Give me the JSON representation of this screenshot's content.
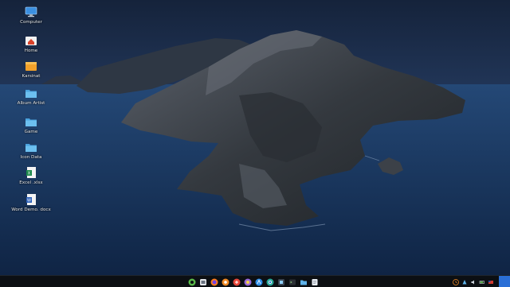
{
  "desktop": {
    "icons": [
      {
        "label": "Computer",
        "icon": "computer-icon"
      },
      {
        "label": "Home",
        "icon": "home-folder-icon"
      },
      {
        "label": "Karsinat",
        "icon": "folder-orange-icon"
      },
      {
        "label": "Album Artist",
        "icon": "folder-icon"
      },
      {
        "label": "Game",
        "icon": "folder-icon"
      },
      {
        "label": "Icon Data",
        "icon": "folder-icon"
      },
      {
        "label": "Excel .xlsx",
        "icon": "excel-file-icon"
      },
      {
        "label": "Word Demo. docx",
        "icon": "word-file-icon"
      }
    ]
  },
  "taskbar": {
    "dock_apps": [
      "start-menu-icon",
      "files-icon",
      "firefox-icon",
      "app-orange-icon",
      "app-red-icon",
      "app-purple-icon",
      "app-store-icon",
      "chrome-icon",
      "software-icon",
      "terminal-icon",
      "folder-icon",
      "text-editor-icon"
    ],
    "tray": {
      "items": [
        "clock-icon",
        "network-icon",
        "volume-icon",
        "battery-icon",
        "flag-icon"
      ]
    }
  },
  "colors": {
    "sky": "#1e2d47",
    "sea": "#1b3b66",
    "land": "#3a3f47",
    "taskbar": "#0c0f13",
    "accent": "#2a6fd6"
  }
}
